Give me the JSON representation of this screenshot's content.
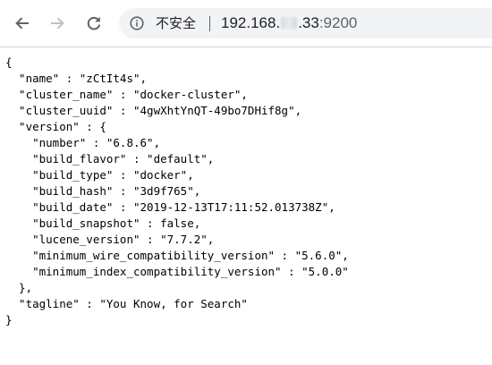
{
  "browser": {
    "security_label": "不安全",
    "url": {
      "host_prefix": "192.168.",
      "host_suffix": ".33",
      "port": ":9200"
    },
    "icons": {
      "back": "arrow-left-icon",
      "forward": "arrow-right-icon",
      "reload": "reload-icon",
      "info": "info-circle-icon"
    }
  },
  "json_lines": [
    "{",
    "  \"name\" : \"zCtIt4s\",",
    "  \"cluster_name\" : \"docker-cluster\",",
    "  \"cluster_uuid\" : \"4gwXhtYnQT-49bo7DHif8g\",",
    "  \"version\" : {",
    "    \"number\" : \"6.8.6\",",
    "    \"build_flavor\" : \"default\",",
    "    \"build_type\" : \"docker\",",
    "    \"build_hash\" : \"3d9f765\",",
    "    \"build_date\" : \"2019-12-13T17:11:52.013738Z\",",
    "    \"build_snapshot\" : false,",
    "    \"lucene_version\" : \"7.7.2\",",
    "    \"minimum_wire_compatibility_version\" : \"5.6.0\",",
    "    \"minimum_index_compatibility_version\" : \"5.0.0\"",
    "  },",
    "  \"tagline\" : \"You Know, for Search\"",
    "}"
  ]
}
